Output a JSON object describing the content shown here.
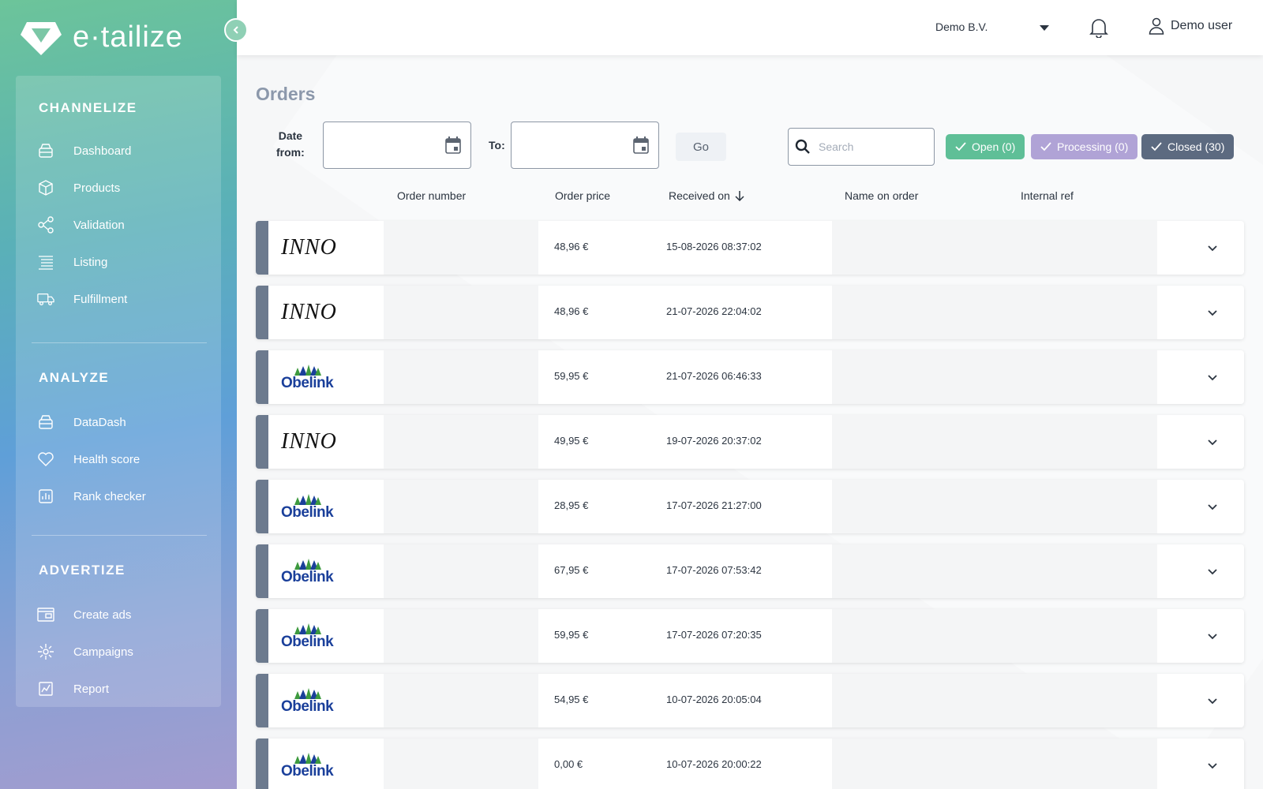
{
  "app": {
    "logo_text": "e·tailize"
  },
  "sidebar": {
    "sections": [
      {
        "title": "CHANNELIZE",
        "items": [
          {
            "label": "Dashboard",
            "icon": "dashboard-icon"
          },
          {
            "label": "Products",
            "icon": "box-icon"
          },
          {
            "label": "Validation",
            "icon": "share-nodes-icon"
          },
          {
            "label": "Listing",
            "icon": "list-icon"
          },
          {
            "label": "Fulfillment",
            "icon": "truck-icon"
          }
        ]
      },
      {
        "title": "ANALYZE",
        "items": [
          {
            "label": "DataDash",
            "icon": "dashboard-icon"
          },
          {
            "label": "Health score",
            "icon": "heart-icon"
          },
          {
            "label": "Rank checker",
            "icon": "bar-chart-icon"
          }
        ]
      },
      {
        "title": "ADVERTIZE",
        "items": [
          {
            "label": "Create ads",
            "icon": "ads-icon"
          },
          {
            "label": "Campaigns",
            "icon": "campaigns-icon"
          },
          {
            "label": "Report",
            "icon": "report-icon"
          }
        ]
      }
    ]
  },
  "topbar": {
    "company": "Demo B.V.",
    "user": "Demo user"
  },
  "page": {
    "title": "Orders",
    "date_from_label_1": "Date",
    "date_from_label_2": "from:",
    "to_label": "To:",
    "date_from_value": "",
    "date_to_value": "",
    "go_label": "Go",
    "search_placeholder": "Search",
    "search_value": "",
    "filters": {
      "open": "Open (0)",
      "processing": "Processing (0)",
      "closed": "Closed (30)"
    }
  },
  "table": {
    "columns": {
      "order_number": "Order number",
      "order_price": "Order price",
      "received_on": "Received on",
      "name_on_order": "Name on order",
      "internal_ref": "Internal ref"
    },
    "sort": {
      "column": "received_on",
      "direction": "descending"
    },
    "rows": [
      {
        "shop": "INNO",
        "price": "48,96 €",
        "received": "15-08-2026 08:37:02"
      },
      {
        "shop": "INNO",
        "price": "48,96 €",
        "received": "21-07-2026 22:04:02"
      },
      {
        "shop": "Obelink",
        "price": "59,95 €",
        "received": "21-07-2026 06:46:33"
      },
      {
        "shop": "INNO",
        "price": "49,95 €",
        "received": "19-07-2026 20:37:02"
      },
      {
        "shop": "Obelink",
        "price": "28,95 €",
        "received": "17-07-2026 21:27:00"
      },
      {
        "shop": "Obelink",
        "price": "67,95 €",
        "received": "17-07-2026 07:53:42"
      },
      {
        "shop": "Obelink",
        "price": "59,95 €",
        "received": "17-07-2026 07:20:35"
      },
      {
        "shop": "Obelink",
        "price": "54,95 €",
        "received": "10-07-2026 20:05:04"
      },
      {
        "shop": "Obelink",
        "price": "0,00 €",
        "received": "10-07-2026 20:00:22"
      }
    ]
  },
  "colors": {
    "open": "#5fbf97",
    "processing": "#b0a3d6",
    "closed": "#5c6a80",
    "row_bar": "#6c7a8e",
    "title": "#8c98ab"
  }
}
